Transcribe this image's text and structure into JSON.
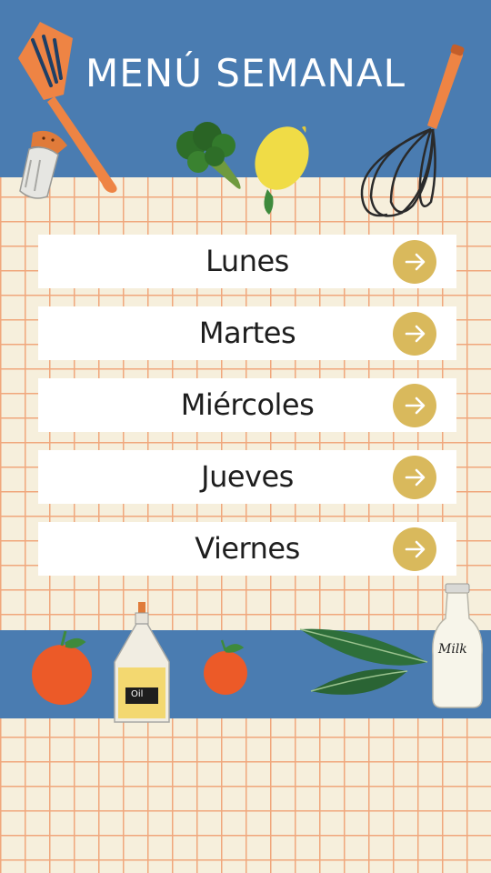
{
  "header": {
    "title": "MENÚ SEMANAL"
  },
  "menu": {
    "days": [
      {
        "label": "Lunes",
        "icon": "arrow-right-icon"
      },
      {
        "label": "Martes",
        "icon": "arrow-right-icon"
      },
      {
        "label": "Miércoles",
        "icon": "arrow-right-icon"
      },
      {
        "label": "Jueves",
        "icon": "arrow-right-icon"
      },
      {
        "label": "Viernes",
        "icon": "arrow-right-icon"
      }
    ]
  },
  "decorations": {
    "oil_label": "Oil",
    "milk_label": "Milk"
  },
  "colors": {
    "band_blue": "#4a7cb1",
    "grid_orange": "#f0a77c",
    "background_cream": "#f6efdc",
    "card_white": "#ffffff",
    "arrow_gold": "#d9b95c"
  }
}
